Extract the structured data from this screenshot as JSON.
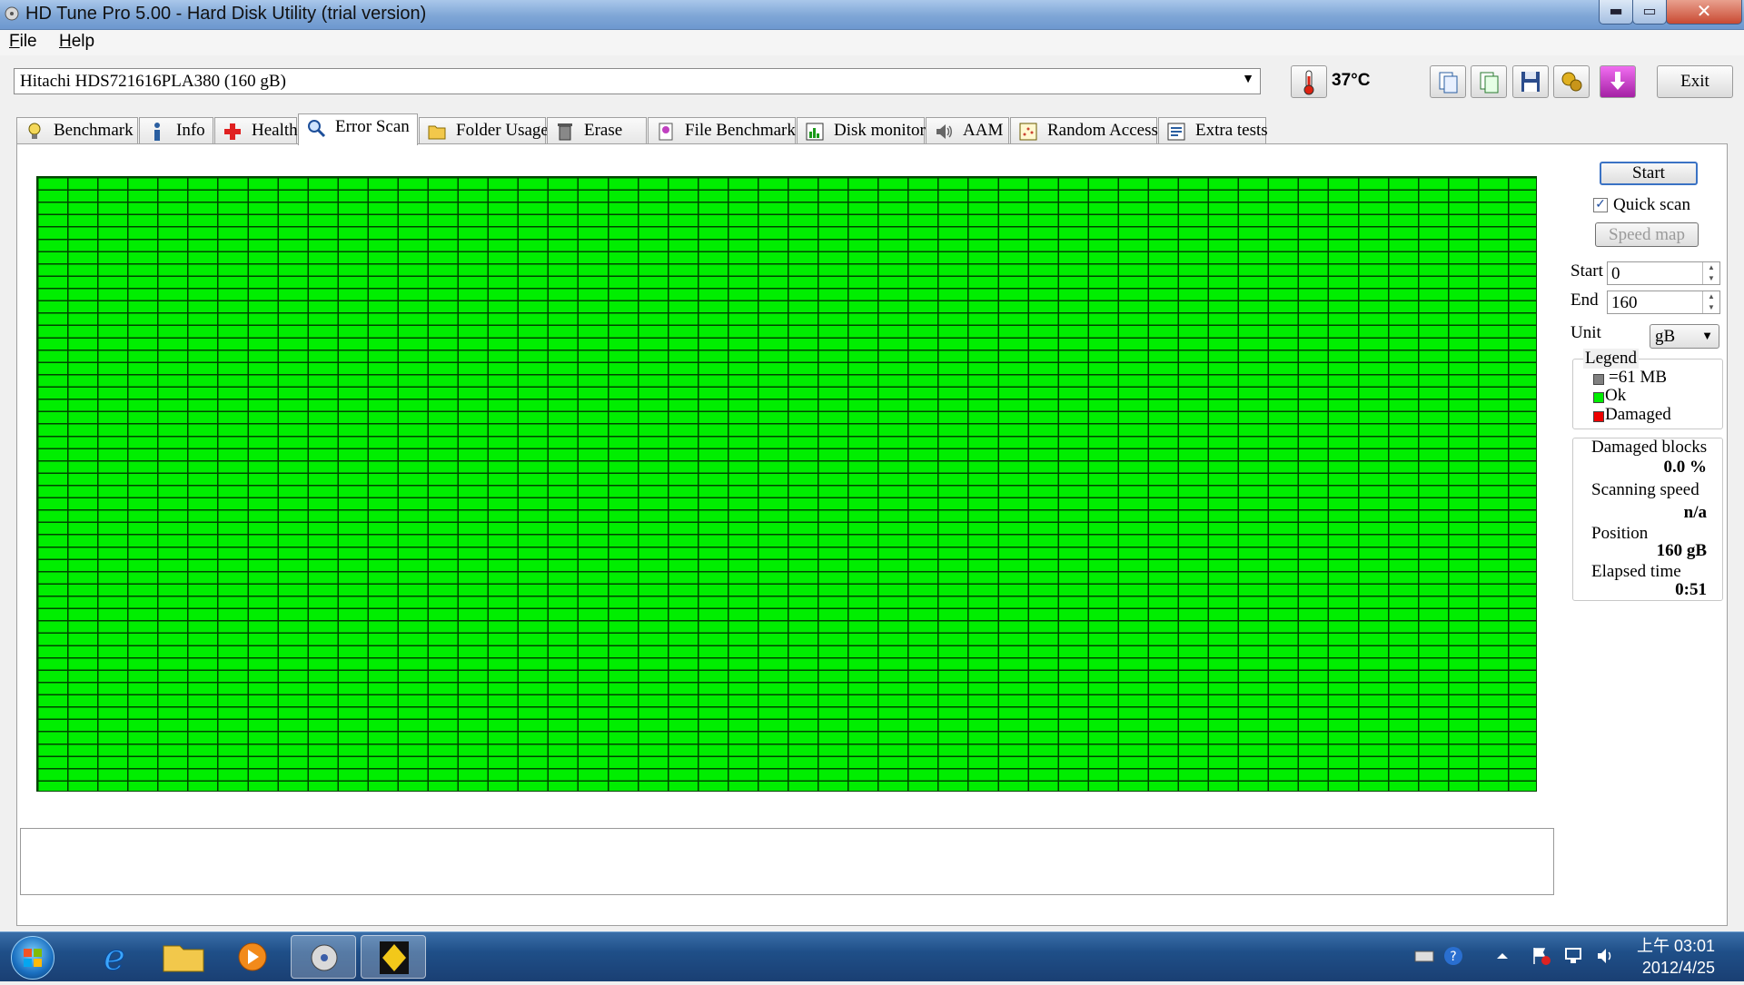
{
  "window": {
    "title": "HD Tune Pro 5.00 - Hard Disk Utility (trial version)",
    "min_glyph": "▬",
    "max_glyph": "▭",
    "close_glyph": "✕"
  },
  "menu": {
    "items": [
      "File",
      "Help"
    ]
  },
  "toolbar": {
    "drive": "Hitachi HDS721616PLA380 (160 gB)",
    "temperature": "37°C",
    "exit_label": "Exit",
    "icons": [
      "copy-text-icon",
      "copy-screenshot-icon",
      "save-icon",
      "options-icon",
      "download-icon"
    ]
  },
  "tabs": [
    {
      "label": "Benchmark",
      "icon": "bulb-icon"
    },
    {
      "label": "Info",
      "icon": "info-icon"
    },
    {
      "label": "Health",
      "icon": "health-cross-icon"
    },
    {
      "label": "Error Scan",
      "icon": "magnifier-icon",
      "active": true
    },
    {
      "label": "Folder Usage",
      "icon": "folder-icon"
    },
    {
      "label": "Erase",
      "icon": "trash-icon"
    },
    {
      "label": "File Benchmark",
      "icon": "file-benchmark-icon"
    },
    {
      "label": "Disk monitor",
      "icon": "disk-monitor-icon"
    },
    {
      "label": "AAM",
      "icon": "speaker-icon"
    },
    {
      "label": "Random Access",
      "icon": "random-access-icon"
    },
    {
      "label": "Extra tests",
      "icon": "extra-tests-icon"
    }
  ],
  "scan": {
    "start_button": "Start",
    "quick_scan_label": "Quick scan",
    "quick_scan_checked": true,
    "speed_map_button": "Speed map",
    "start_label": "Start",
    "start_value": "0",
    "end_label": "End",
    "end_value": "160",
    "unit_label": "Unit",
    "unit_value": "gB",
    "grid_status": "Ok"
  },
  "legend": {
    "title": "Legend",
    "items": [
      {
        "label": "=61 MB",
        "color": "#808080"
      },
      {
        "label": "Ok",
        "color": "#00ee00"
      },
      {
        "label": "Damaged",
        "color": "#ee0000"
      }
    ]
  },
  "stats": {
    "damaged_label": "Damaged blocks",
    "damaged_value": "0.0 %",
    "speed_label": "Scanning speed",
    "speed_value": "n/a",
    "position_label": "Position",
    "position_value": "160 gB",
    "elapsed_label": "Elapsed time",
    "elapsed_value": "0:51"
  },
  "taskbar": {
    "apps": [
      "internet-explorer-icon",
      "explorer-folder-icon",
      "media-player-icon",
      "hd-tune-icon",
      "app-icon-yellow"
    ],
    "clock_time": "上午 03:01",
    "clock_date": "2012/4/25",
    "tray_icons": [
      "keyboard-icon",
      "help-icon",
      "chevron-up-icon",
      "action-center-flag-icon",
      "network-icon",
      "volume-icon"
    ]
  }
}
